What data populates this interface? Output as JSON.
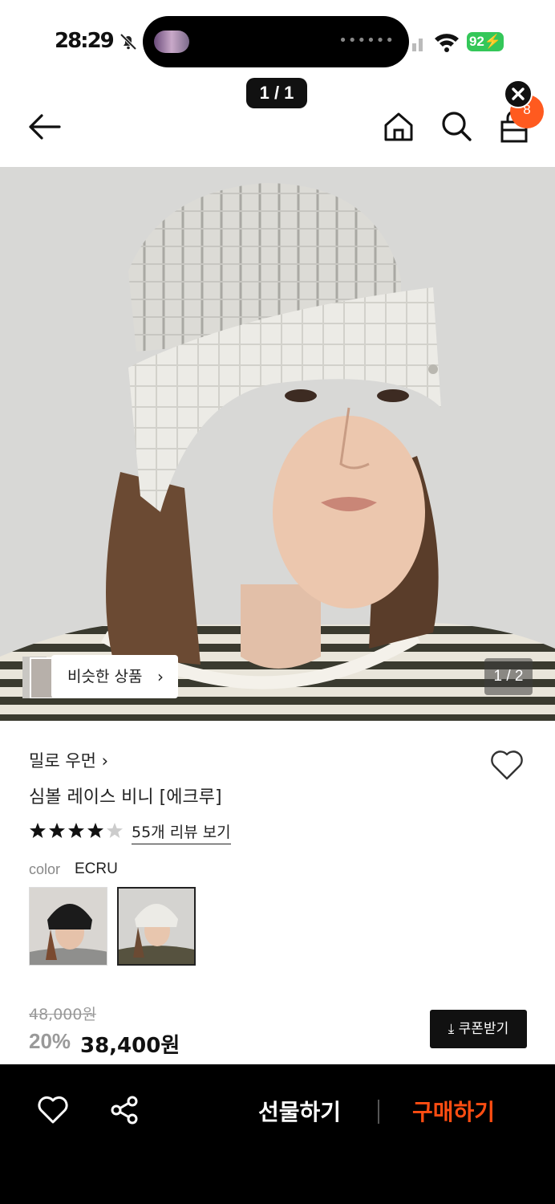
{
  "status_bar": {
    "time": "28:29",
    "battery": "92"
  },
  "page_indicator": "1 / 1",
  "header": {
    "cart_count": "8"
  },
  "gallery": {
    "similar_label": "비슷한 상품",
    "counter": "1 / 2"
  },
  "product": {
    "brand": "밀로 우먼",
    "name": "심볼 레이스 비니 [에크루]",
    "rating": 4.5,
    "review_link": "55개 리뷰 보기",
    "color_label": "color",
    "color_value": "ECRU",
    "swatch_count": 2,
    "price_original": "48,000원",
    "discount": "20%",
    "price_final": "38,400원",
    "coupon_label": "쿠폰받기"
  },
  "bottom_bar": {
    "gift_label": "선물하기",
    "buy_label": "구매하기"
  },
  "colors": {
    "accent": "#ff4d12",
    "badge": "#ff5a1f",
    "battery": "#34c759"
  },
  "icons": [
    "back-icon",
    "home-icon",
    "search-icon",
    "cart-icon",
    "close-icon",
    "heart-icon",
    "share-icon",
    "chevron-right-icon",
    "download-icon",
    "star-icon"
  ]
}
